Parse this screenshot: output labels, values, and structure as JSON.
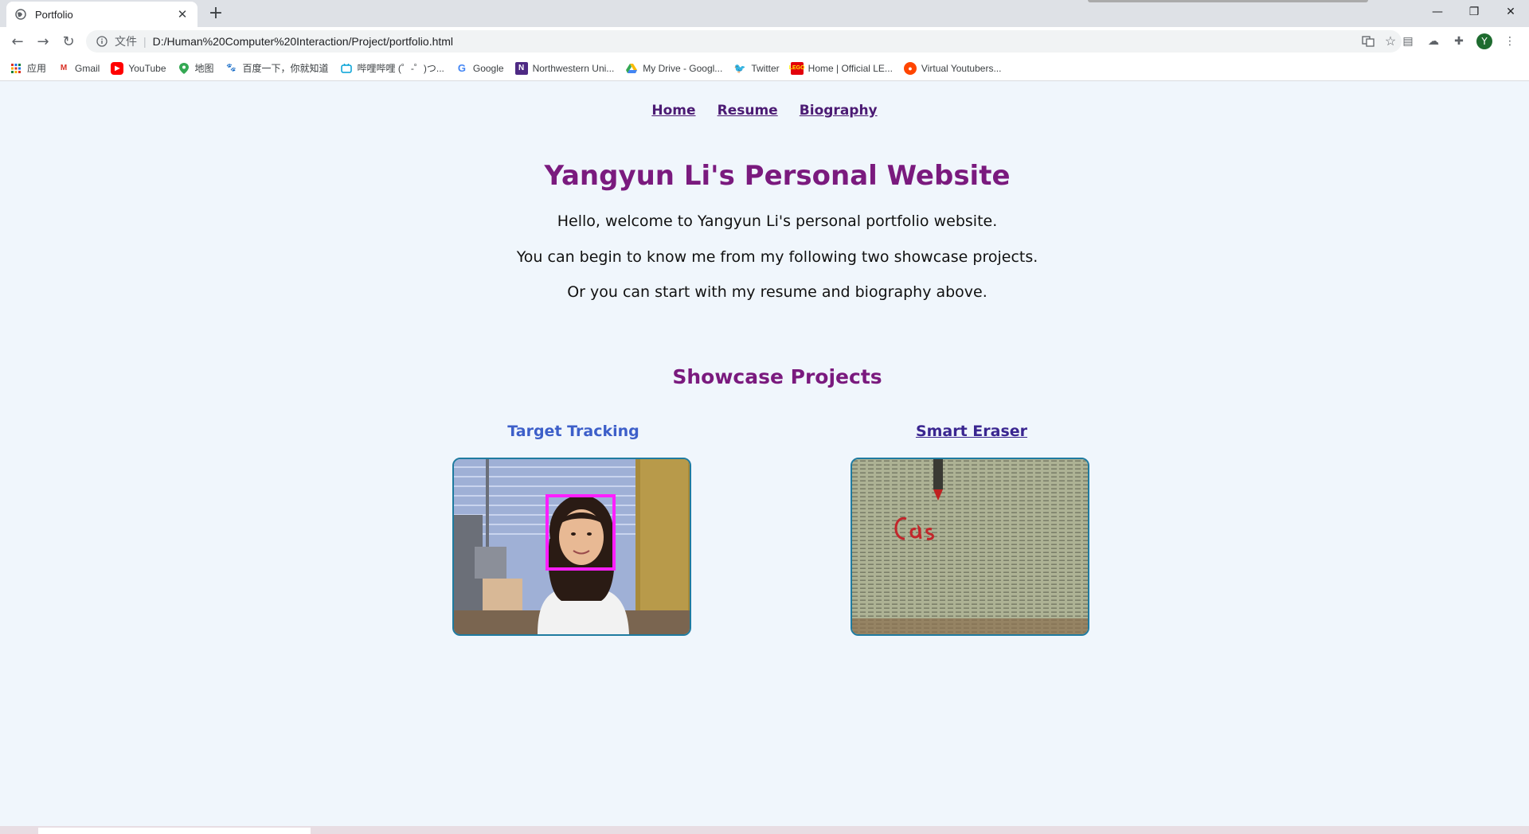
{
  "browser": {
    "tab_title": "Portfolio",
    "new_tab": "+",
    "url_label": "文件",
    "url": "D:/Human%20Computer%20Interaction/Project/portfolio.html",
    "profile_initial": "Y"
  },
  "bookmarks": [
    {
      "label": "应用",
      "icon": "apps-icon"
    },
    {
      "label": "Gmail",
      "icon": "gmail-icon"
    },
    {
      "label": "YouTube",
      "icon": "youtube-icon"
    },
    {
      "label": "地图",
      "icon": "maps-icon"
    },
    {
      "label": "百度一下，你就知道",
      "icon": "baidu-icon"
    },
    {
      "label": "哔哩哔哩 (゜-゜)つ...",
      "icon": "bilibili-icon"
    },
    {
      "label": "Google",
      "icon": "google-icon"
    },
    {
      "label": "Northwestern Uni...",
      "icon": "northwestern-icon"
    },
    {
      "label": "My Drive - Googl...",
      "icon": "drive-icon"
    },
    {
      "label": "Twitter",
      "icon": "twitter-icon"
    },
    {
      "label": "Home | Official LE...",
      "icon": "lego-icon"
    },
    {
      "label": "Virtual Youtubers...",
      "icon": "reddit-icon"
    }
  ],
  "nav": {
    "home": "Home",
    "resume": "Resume",
    "biography": "Biography"
  },
  "main": {
    "title": "Yangyun Li's Personal Website",
    "intro_1": "Hello, welcome to Yangyun Li's personal portfolio website.",
    "intro_2": "You can begin to know me from my following two showcase projects.",
    "intro_3": "Or you can start with my resume and biography above."
  },
  "showcase": {
    "heading": "Showcase Projects",
    "projects": [
      {
        "title": "Target Tracking"
      },
      {
        "title": "Smart Eraser"
      }
    ]
  },
  "colors": {
    "page_bg": "#f0f6fc",
    "heading": "#7a1a7e",
    "nav_link": "#4b1a73",
    "project_link": "#3d5fc9",
    "thumb_border": "#1f7ba0"
  }
}
